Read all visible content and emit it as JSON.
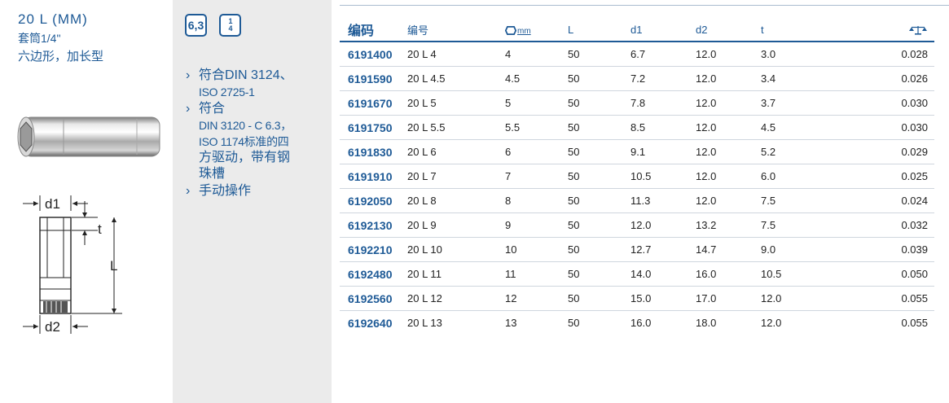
{
  "product": {
    "title": "20 L (MM)",
    "subtitle1": "套筒1/4\"",
    "subtitle2": "六边形，加长型"
  },
  "drive_badges": {
    "size": "6,3",
    "frac_num": "1",
    "frac_den": "4"
  },
  "dimension_labels": {
    "d1": "d1",
    "t": "t",
    "L": "L",
    "d2": "d2"
  },
  "features": [
    {
      "lines": [
        "符合DIN 3124、",
        "ISO 2725-1"
      ]
    },
    {
      "lines": [
        "符合",
        "DIN 3120 - C 6.3，",
        "ISO 1174标准的四",
        "方驱动，带有钢",
        "珠槽"
      ]
    },
    {
      "lines": [
        "手动操作"
      ]
    }
  ],
  "table": {
    "headers": {
      "code": "编码",
      "number": "编号",
      "size_unit": "mm",
      "L": "L",
      "d1": "d1",
      "d2": "d2",
      "t": "t"
    },
    "icons": {
      "size": "hex-mm-icon",
      "weight": "scale-kg-icon"
    },
    "rows": [
      {
        "code": "6191400",
        "number": "20 L 4",
        "size": "4",
        "L": "50",
        "d1": "6.7",
        "d2": "12.0",
        "t": "3.0",
        "weight": "0.028"
      },
      {
        "code": "6191590",
        "number": "20 L 4.5",
        "size": "4.5",
        "L": "50",
        "d1": "7.2",
        "d2": "12.0",
        "t": "3.4",
        "weight": "0.026"
      },
      {
        "code": "6191670",
        "number": "20 L 5",
        "size": "5",
        "L": "50",
        "d1": "7.8",
        "d2": "12.0",
        "t": "3.7",
        "weight": "0.030"
      },
      {
        "code": "6191750",
        "number": "20 L 5.5",
        "size": "5.5",
        "L": "50",
        "d1": "8.5",
        "d2": "12.0",
        "t": "4.5",
        "weight": "0.030"
      },
      {
        "code": "6191830",
        "number": "20 L 6",
        "size": "6",
        "L": "50",
        "d1": "9.1",
        "d2": "12.0",
        "t": "5.2",
        "weight": "0.029"
      },
      {
        "code": "6191910",
        "number": "20 L 7",
        "size": "7",
        "L": "50",
        "d1": "10.5",
        "d2": "12.0",
        "t": "6.0",
        "weight": "0.025"
      },
      {
        "code": "6192050",
        "number": "20 L 8",
        "size": "8",
        "L": "50",
        "d1": "11.3",
        "d2": "12.0",
        "t": "7.5",
        "weight": "0.024"
      },
      {
        "code": "6192130",
        "number": "20 L 9",
        "size": "9",
        "L": "50",
        "d1": "12.0",
        "d2": "13.2",
        "t": "7.5",
        "weight": "0.032"
      },
      {
        "code": "6192210",
        "number": "20 L 10",
        "size": "10",
        "L": "50",
        "d1": "12.7",
        "d2": "14.7",
        "t": "9.0",
        "weight": "0.039"
      },
      {
        "code": "6192480",
        "number": "20 L 11",
        "size": "11",
        "L": "50",
        "d1": "14.0",
        "d2": "16.0",
        "t": "10.5",
        "weight": "0.050"
      },
      {
        "code": "6192560",
        "number": "20 L 12",
        "size": "12",
        "L": "50",
        "d1": "15.0",
        "d2": "17.0",
        "t": "12.0",
        "weight": "0.055"
      },
      {
        "code": "6192640",
        "number": "20 L 13",
        "size": "13",
        "L": "50",
        "d1": "16.0",
        "d2": "18.0",
        "t": "12.0",
        "weight": "0.055"
      }
    ]
  },
  "colors": {
    "brand_blue": "#1e5a96",
    "sidebar_gray": "#ebebeb"
  }
}
